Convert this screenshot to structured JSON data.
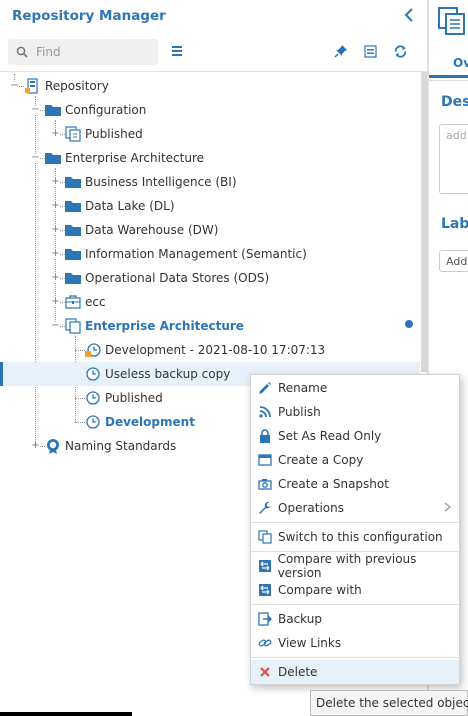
{
  "header": {
    "title": "Repository Manager",
    "collapse_icon": "chevron-left-icon"
  },
  "toolbar": {
    "search_placeholder": "Find",
    "icons": [
      "search-icon",
      "menu-icon",
      "pin-icon",
      "collapse-all-icon",
      "refresh-icon"
    ]
  },
  "tree": {
    "items": [
      {
        "label": "Repository",
        "icon": "repository-icon"
      },
      {
        "label": "Configuration",
        "icon": "folder-icon"
      },
      {
        "label": "Published",
        "icon": "configuration-icon"
      },
      {
        "label": "Enterprise Architecture",
        "icon": "folder-icon"
      },
      {
        "label": "Business Intelligence (BI)",
        "icon": "folder-icon"
      },
      {
        "label": "Data Lake (DL)",
        "icon": "folder-icon"
      },
      {
        "label": "Data Warehouse (DW)",
        "icon": "folder-icon"
      },
      {
        "label": "Information Management (Semantic)",
        "icon": "folder-icon"
      },
      {
        "label": "Operational Data Stores (ODS)",
        "icon": "folder-icon"
      },
      {
        "label": "ecc",
        "icon": "briefcase-icon"
      },
      {
        "label": "Enterprise Architecture",
        "icon": "configuration-icon"
      },
      {
        "label": "Development - 2021-08-10 17:07:13",
        "icon": "locked-clock-icon"
      },
      {
        "label": "Useless backup copy",
        "icon": "clock-icon"
      },
      {
        "label": "Published",
        "icon": "clock-icon"
      },
      {
        "label": "Development",
        "icon": "clock-icon"
      },
      {
        "label": "Naming Standards",
        "icon": "naming-standards-icon"
      }
    ]
  },
  "right_panel": {
    "tab_label": "Ov",
    "section1": "Desc",
    "section1_placeholder": "add",
    "section2": "Labe",
    "section2_button": "Add"
  },
  "context_menu": {
    "items": [
      {
        "label": "Rename",
        "icon": "pencil-icon"
      },
      {
        "label": "Publish",
        "icon": "rss-icon"
      },
      {
        "label": "Set As Read Only",
        "icon": "lock-icon"
      },
      {
        "label": "Create a Copy",
        "icon": "copy-window-icon"
      },
      {
        "label": "Create a Snapshot",
        "icon": "camera-icon"
      },
      {
        "label": "Operations",
        "icon": "wrench-icon"
      },
      {
        "label": "Switch to this configuration",
        "icon": "switch-config-icon"
      },
      {
        "label": "Compare with previous version",
        "icon": "compare-icon"
      },
      {
        "label": "Compare with",
        "icon": "compare-icon"
      },
      {
        "label": "Backup",
        "icon": "backup-icon"
      },
      {
        "label": "View Links",
        "icon": "link-icon"
      },
      {
        "label": "Delete",
        "icon": "delete-x-icon"
      }
    ]
  },
  "tooltip": "Delete the selected object",
  "colors": {
    "accent": "#2e75b6",
    "selection": "#e6f1fa",
    "delete": "#d9534f"
  }
}
